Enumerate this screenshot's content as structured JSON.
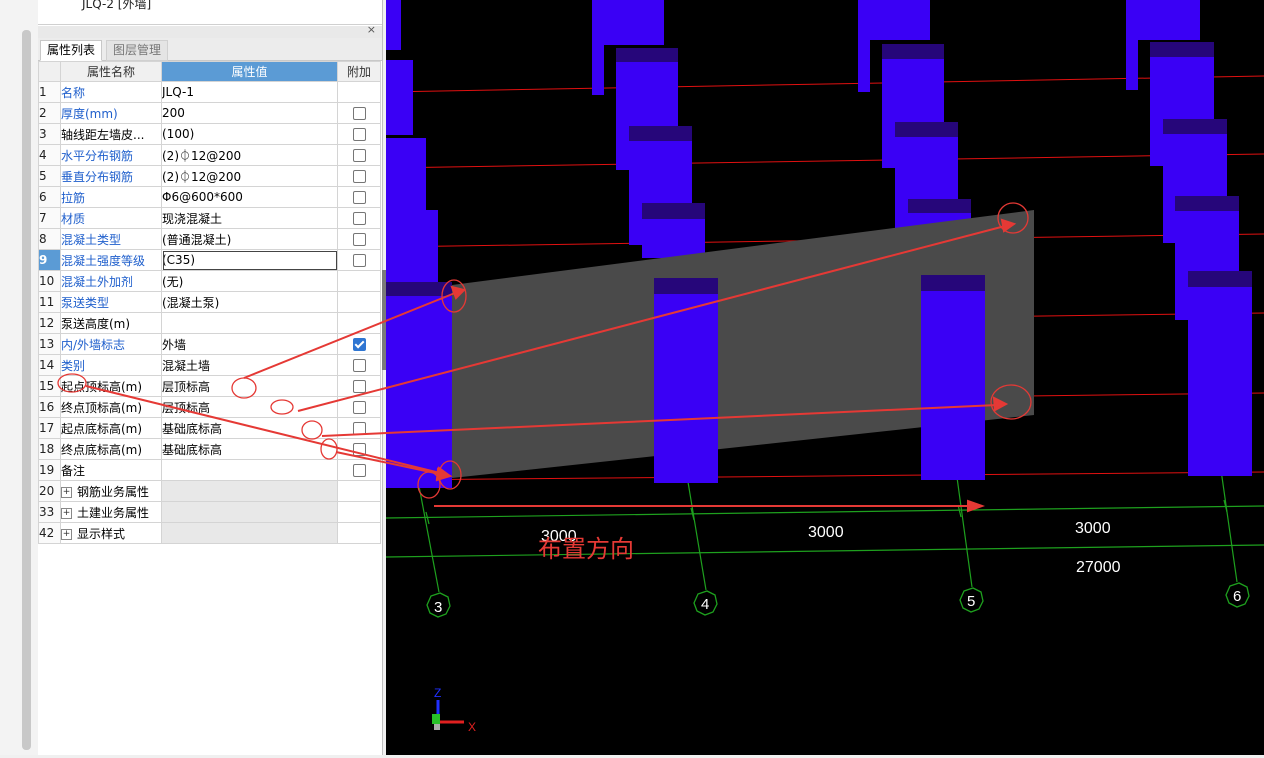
{
  "tree": {
    "item": "JLQ-2 [外墙]"
  },
  "panel": {
    "close_glyph": "×"
  },
  "tabs": [
    {
      "label": "属性列表"
    },
    {
      "label": "图层管理"
    }
  ],
  "columns": {
    "name": "属性名称",
    "value": "属性值",
    "extra": "附加"
  },
  "rows": [
    {
      "num": "1",
      "name": "名称",
      "value": "JLQ-1",
      "blue": true,
      "checkbox": false,
      "has_cb": false
    },
    {
      "num": "2",
      "name": "厚度(mm)",
      "value": "200",
      "blue": true,
      "checkbox": false,
      "has_cb": true
    },
    {
      "num": "3",
      "name": "轴线距左墙皮...",
      "value": "(100)",
      "blue": false,
      "checkbox": false,
      "has_cb": true
    },
    {
      "num": "4",
      "name": "水平分布钢筋",
      "value": "(2)⏀12@200",
      "blue": true,
      "checkbox": false,
      "has_cb": true
    },
    {
      "num": "5",
      "name": "垂直分布钢筋",
      "value": "(2)⏀12@200",
      "blue": true,
      "checkbox": false,
      "has_cb": true
    },
    {
      "num": "6",
      "name": "拉筋",
      "value": "Φ6@600*600",
      "blue": true,
      "checkbox": false,
      "has_cb": true
    },
    {
      "num": "7",
      "name": "材质",
      "value": "现浇混凝土",
      "blue": true,
      "checkbox": false,
      "has_cb": true
    },
    {
      "num": "8",
      "name": "混凝土类型",
      "value": "(普通混凝土)",
      "blue": true,
      "checkbox": false,
      "has_cb": true
    },
    {
      "num": "9",
      "name": "混凝土强度等级",
      "value": "(C35)",
      "blue": true,
      "checkbox": false,
      "has_cb": true,
      "selected": true
    },
    {
      "num": "10",
      "name": "混凝土外加剂",
      "value": "(无)",
      "blue": true,
      "checkbox": false,
      "has_cb": false
    },
    {
      "num": "11",
      "name": "泵送类型",
      "value": "(混凝土泵)",
      "blue": true,
      "checkbox": false,
      "has_cb": false
    },
    {
      "num": "12",
      "name": "泵送高度(m)",
      "value": "",
      "blue": false,
      "checkbox": false,
      "has_cb": false
    },
    {
      "num": "13",
      "name": "内/外墙标志",
      "value": "外墙",
      "blue": true,
      "checkbox": true,
      "has_cb": true
    },
    {
      "num": "14",
      "name": "类别",
      "value": "混凝土墙",
      "blue": true,
      "checkbox": false,
      "has_cb": true
    },
    {
      "num": "15",
      "name": "起点顶标高(m)",
      "value": "层顶标高",
      "blue": false,
      "checkbox": false,
      "has_cb": true
    },
    {
      "num": "16",
      "name": "终点顶标高(m)",
      "value": "层顶标高",
      "blue": false,
      "checkbox": false,
      "has_cb": true
    },
    {
      "num": "17",
      "name": "起点底标高(m)",
      "value": "基础底标高",
      "blue": false,
      "checkbox": false,
      "has_cb": true
    },
    {
      "num": "18",
      "name": "终点底标高(m)",
      "value": "基础底标高",
      "blue": false,
      "checkbox": false,
      "has_cb": true
    },
    {
      "num": "19",
      "name": "备注",
      "value": "",
      "blue": false,
      "checkbox": false,
      "has_cb": true
    },
    {
      "num": "20",
      "name": "钢筋业务属性",
      "value": "",
      "group": true
    },
    {
      "num": "33",
      "name": "土建业务属性",
      "value": "",
      "group": true
    },
    {
      "num": "42",
      "name": "显示样式",
      "value": "",
      "group": true
    }
  ],
  "viewport": {
    "dimensions": [
      "3000",
      "3000",
      "3000",
      "27000"
    ],
    "axes": [
      "3",
      "4",
      "5",
      "6"
    ],
    "annotation": "布置方向",
    "axis_x": "X",
    "axis_z": "Z"
  },
  "colors": {
    "column": "#3a00f5",
    "column_top": "#26067a",
    "wall": "#4a4a4a",
    "grid_red": "#e01010",
    "grid_green": "#1ea01e",
    "annotation": "#e53935",
    "selected": "#5b9bd5"
  }
}
